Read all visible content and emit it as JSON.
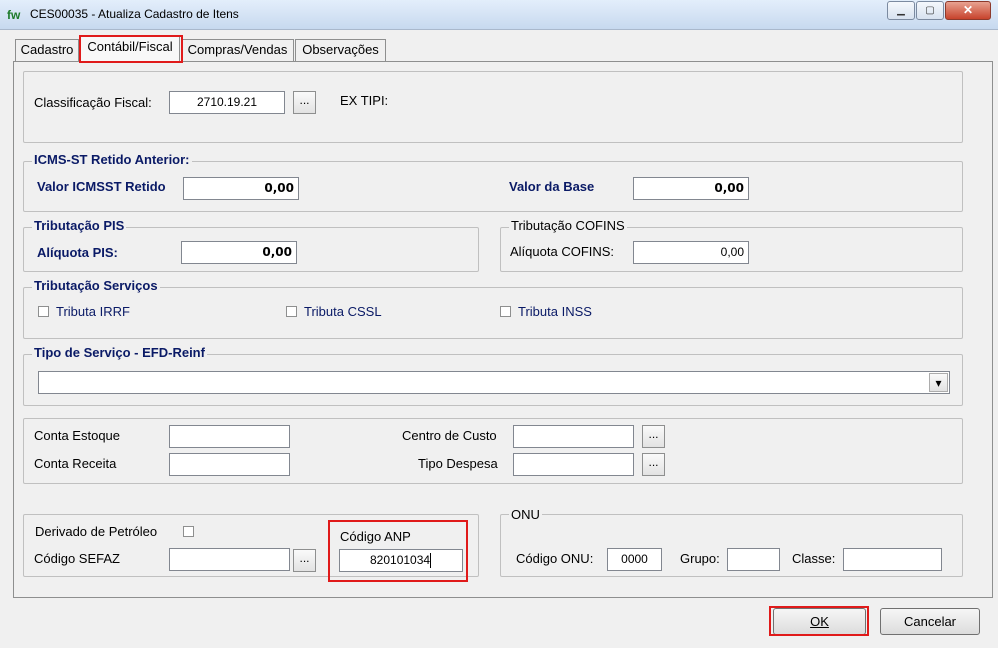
{
  "window": {
    "title": "CES00035 - Atualiza Cadastro de Itens",
    "icon_text": "fw",
    "controls": {
      "minimize": "▁",
      "maximize": "▢",
      "close": "✕"
    }
  },
  "tabs": [
    {
      "label": "Cadastro"
    },
    {
      "label": "Contábil/Fiscal"
    },
    {
      "label": "Compras/Vendas"
    },
    {
      "label": "Observações"
    }
  ],
  "fiscal": {
    "classificacao_label": "Classificação Fiscal:",
    "classificacao_value": "2710.19.21",
    "ex_tipi_label": "EX TIPI:",
    "ellipsis": "..."
  },
  "icms_st": {
    "legend": "ICMS-ST Retido Anterior:",
    "valor_retido_label": "Valor ICMSST Retido",
    "valor_retido_value": "0,00",
    "valor_base_label": "Valor da Base",
    "valor_base_value": "0,00"
  },
  "pis": {
    "legend": "Tributação PIS",
    "aliquota_label": "Alíquota PIS:",
    "aliquota_value": "0,00"
  },
  "cofins": {
    "legend": "Tributação COFINS",
    "aliquota_label": "Alíquota COFINS:",
    "aliquota_value": "0,00"
  },
  "servicos": {
    "legend": "Tributação Serviços",
    "irrf_label": "Tributa IRRF",
    "cssl_label": "Tributa CSSL",
    "inss_label": "Tributa INSS"
  },
  "efd": {
    "legend": "Tipo de Serviço - EFD-Reinf",
    "selected": "",
    "arrow": "▾"
  },
  "contas": {
    "estoque_label": "Conta  Estoque",
    "estoque_value": "",
    "receita_label": "Conta Receita",
    "receita_value": "",
    "centro_custo_label": "Centro de Custo",
    "centro_custo_value": "",
    "tipo_despesa_label": "Tipo Despesa",
    "tipo_despesa_value": ""
  },
  "petroleo": {
    "derivado_label": "Derivado de Petróleo",
    "sefaz_label": "Código SEFAZ",
    "sefaz_value": "",
    "anp_label": "Código ANP",
    "anp_value": "820101034"
  },
  "onu": {
    "legend": "ONU",
    "codigo_label": "Código ONU:",
    "codigo_value": "0000",
    "grupo_label": "Grupo:",
    "grupo_value": "",
    "classe_label": "Classe:",
    "classe_value": ""
  },
  "footer": {
    "ok_label": "OK",
    "cancel_label": "Cancelar"
  },
  "colors": {
    "highlight_red": "#e01a1a",
    "label_navy": "#0a1a66"
  }
}
